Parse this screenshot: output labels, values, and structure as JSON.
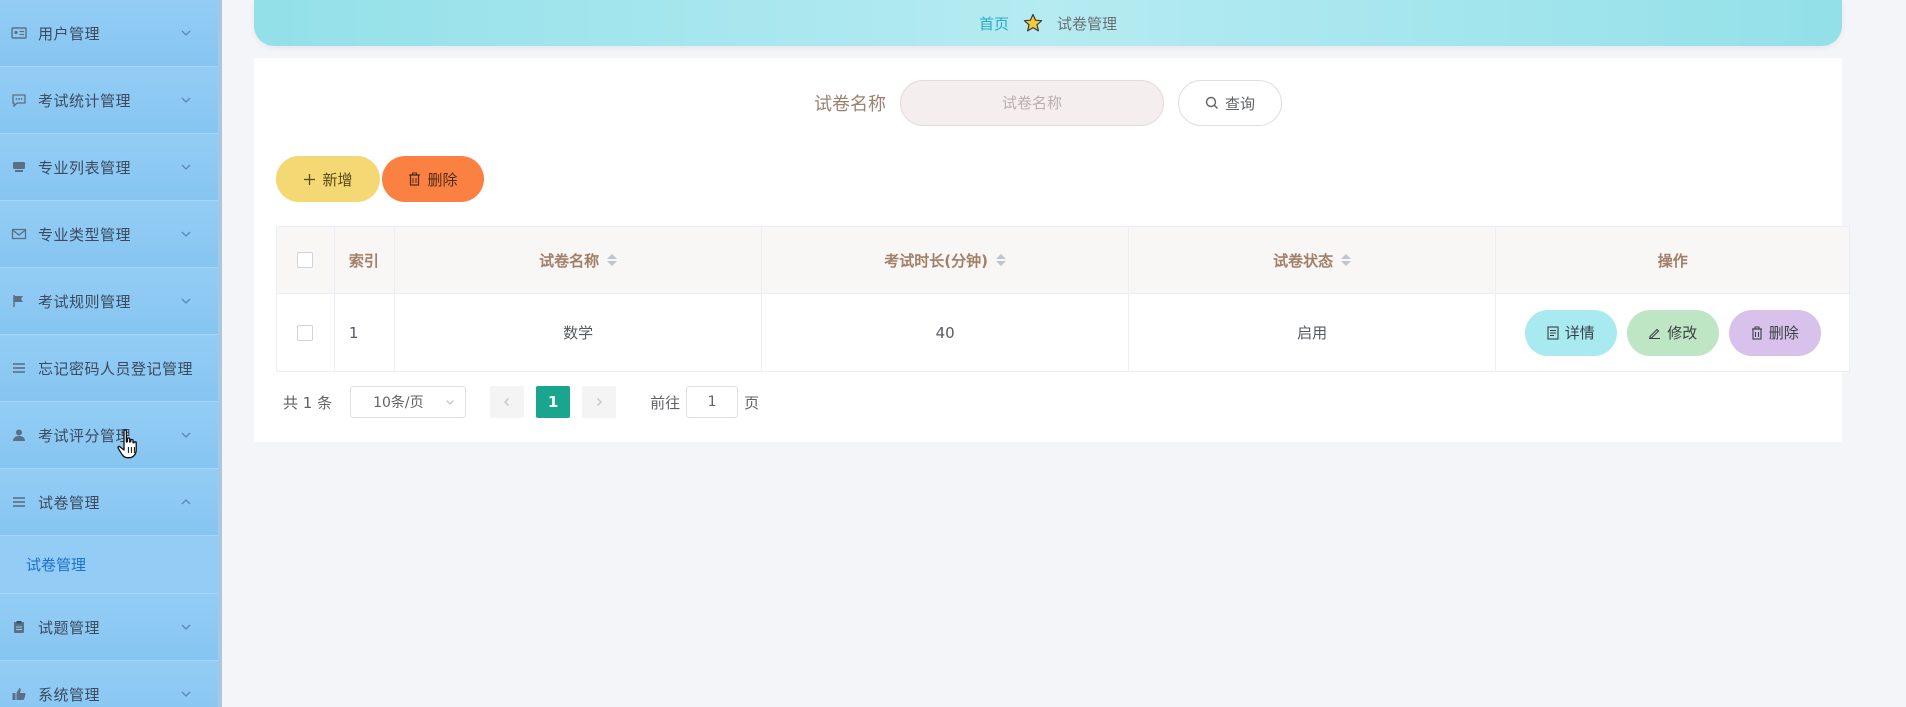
{
  "sidebar": {
    "items": [
      {
        "label": "用户管理",
        "icon": "id-card-icon"
      },
      {
        "label": "考试统计管理",
        "icon": "chat-bubble-icon"
      },
      {
        "label": "专业列表管理",
        "icon": "server-icon"
      },
      {
        "label": "专业类型管理",
        "icon": "envelope-icon"
      },
      {
        "label": "考试规则管理",
        "icon": "flag-icon"
      },
      {
        "label": "忘记密码人员登记管理",
        "icon": "list-icon"
      },
      {
        "label": "考试评分管理",
        "icon": "user-icon"
      },
      {
        "label": "试卷管理",
        "icon": "list-icon",
        "expanded": true,
        "submenu": [
          {
            "label": "试卷管理"
          }
        ]
      },
      {
        "label": "试题管理",
        "icon": "clipboard-icon"
      },
      {
        "label": "系统管理",
        "icon": "thumbs-up-icon"
      }
    ]
  },
  "breadcrumb": {
    "home": "首页",
    "current": "试卷管理"
  },
  "search": {
    "label": "试卷名称",
    "placeholder": "试卷名称",
    "button": "查询"
  },
  "actions": {
    "add": "新增",
    "delete": "删除"
  },
  "table": {
    "columns": [
      "索引",
      "试卷名称",
      "考试时长(分钟)",
      "试卷状态",
      "操作"
    ],
    "rows": [
      {
        "index": "1",
        "name": "数学",
        "duration": "40",
        "status": "启用"
      }
    ],
    "ops": {
      "detail": "详情",
      "edit": "修改",
      "delete": "删除"
    }
  },
  "pagination": {
    "total": "共 1 条",
    "page_size": "10条/页",
    "current_page": "1",
    "goto_label": "前往",
    "goto_value": "1",
    "page_suffix": "页"
  },
  "colors": {
    "sidebar_bg": "#8fcaf3",
    "crumb_bg": "#a6e6ee",
    "add_btn": "#f4d873",
    "delete_btn": "#fb8142",
    "page_active": "#1aa58e",
    "detail_btn": "#a9e9f0",
    "edit_btn": "#bfe6c4",
    "op_delete_btn": "#d8c1ea"
  }
}
